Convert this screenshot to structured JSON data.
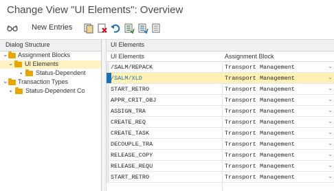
{
  "title": "Change View \"UI Elements\": Overview",
  "toolbar": {
    "new_entries_label": "New Entries"
  },
  "left_pane": {
    "header": "Dialog Structure",
    "tree": [
      {
        "label": "Assignment Blocks"
      },
      {
        "label": "UI Elements"
      },
      {
        "label": "Status-Dependent"
      },
      {
        "label": "Transaction Types"
      },
      {
        "label": "Status-Dependent Co"
      }
    ]
  },
  "table": {
    "title": "UI Elements",
    "columns": [
      "UI Elements",
      "Assignment Block"
    ],
    "rows": [
      {
        "ui": "/SALM/REPACK",
        "block": "Transport Management"
      },
      {
        "ui": "/SALM/XLD",
        "block": "Transport Management"
      },
      {
        "ui": "START_RETRO",
        "block": "Transport Management"
      },
      {
        "ui": "APPR_CRIT_OBJ",
        "block": "Transport Management"
      },
      {
        "ui": "ASSIGN_TRA",
        "block": "Transport Management"
      },
      {
        "ui": "CREATE_REQ",
        "block": "Transport Management"
      },
      {
        "ui": "CREATE_TASK",
        "block": "Transport Management"
      },
      {
        "ui": "DECOUPLE_TRA",
        "block": "Transport Management"
      },
      {
        "ui": "RELEASE_COPY",
        "block": "Transport Management"
      },
      {
        "ui": "RELEASE_REQU",
        "block": "Transport Management"
      },
      {
        "ui": "START_RETRO",
        "block": "Transport Management"
      }
    ]
  }
}
